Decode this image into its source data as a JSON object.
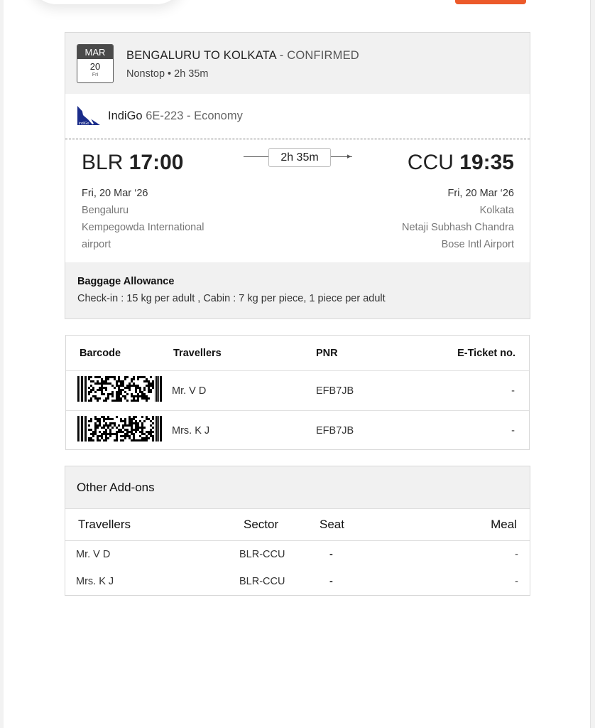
{
  "flight": {
    "date_month": "MAR",
    "date_day": "20",
    "date_weekday": "Fri",
    "route": "BENGALURU TO KOLKATA",
    "status": " - CONFIRMED",
    "sub": "Nonstop • 2h 35m",
    "airline": "IndiGo",
    "flight_info": " 6E-223 - Economy",
    "airline_logo_text": "indiGo",
    "duration": "2h 35m",
    "dep_code": "BLR",
    "dep_time": "17:00",
    "dep_date": "Fri, 20 Mar ‘26",
    "dep_city": "Bengaluru",
    "dep_airport_1": "Kempegowda International",
    "dep_airport_2": "airport",
    "arr_code": "CCU",
    "arr_time": "19:35",
    "arr_date": "Fri, 20 Mar ‘26",
    "arr_city": "Kolkata",
    "arr_airport_1": "Netaji Subhash Chandra",
    "arr_airport_2": "Bose Intl Airport"
  },
  "baggage": {
    "title": "Baggage Allowance",
    "text": "Check-in : 15 kg per adult , Cabin : 7 kg per piece, 1 piece per adult"
  },
  "passengers": {
    "headers": [
      "Barcode",
      "Travellers",
      "PNR",
      "E-Ticket no."
    ],
    "rows": [
      {
        "name": "Mr. V D",
        "pnr": "EFB7JB",
        "eticket": "-"
      },
      {
        "name": "Mrs. K J",
        "pnr": "EFB7JB",
        "eticket": "-"
      }
    ]
  },
  "addons": {
    "title": "Other Add-ons",
    "headers": [
      "Travellers",
      "Sector",
      "Seat",
      "Meal"
    ],
    "rows": [
      {
        "name": "Mr. V D",
        "sector": "BLR-CCU",
        "seat": "-",
        "meal": "-"
      },
      {
        "name": "Mrs. K J",
        "sector": "BLR-CCU",
        "seat": "-",
        "meal": "-"
      }
    ]
  },
  "colors": {
    "accent": "#ec5a2a",
    "airline_blue": "#1a2c8a",
    "header_bg": "#f1f1f1"
  }
}
